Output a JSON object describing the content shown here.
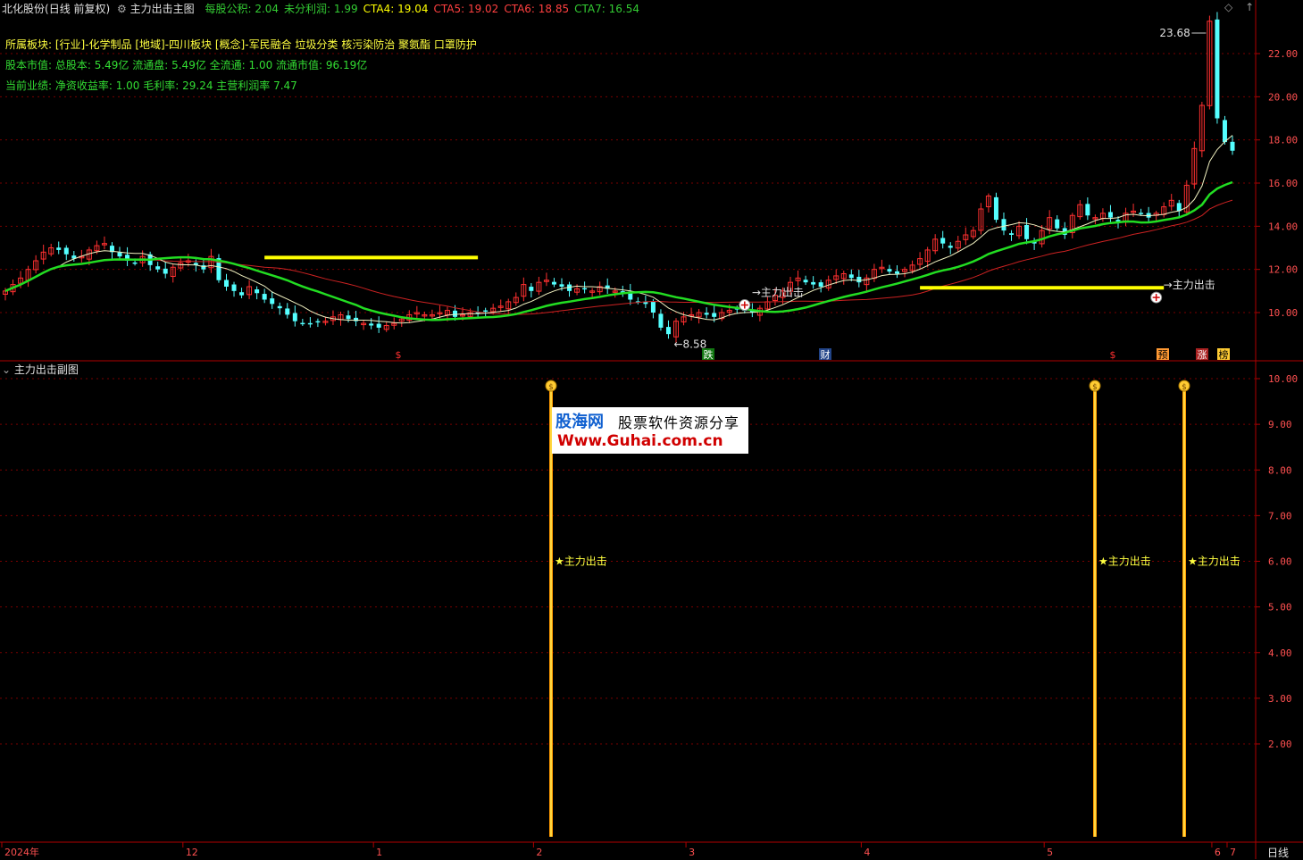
{
  "header": {
    "stock_name": "北化股份",
    "period": "(日线 前复权)",
    "indicator_main": "主力出击主图",
    "fields": [
      {
        "label": "每股公积:",
        "value": "2.04",
        "color": "#33cc33"
      },
      {
        "label": "未分利润:",
        "value": "1.99",
        "color": "#33cc33"
      },
      {
        "label": "CTA4:",
        "value": "19.04",
        "color": "#ffff00"
      },
      {
        "label": "CTA5:",
        "value": "19.02",
        "color": "#ff4040"
      },
      {
        "label": "CTA6:",
        "value": "18.85",
        "color": "#ff4040"
      },
      {
        "label": "CTA7:",
        "value": "16.54",
        "color": "#33cc33"
      }
    ]
  },
  "info_lines": {
    "sector": "所属板块: [行业]-化学制品 [地域]-四川板块 [概念]-军民融合 垃圾分类 核污染防治 聚氨酯 口罩防护",
    "market_value": "股本市值: 总股本: 5.49亿 流通盘: 5.49亿 全流通: 1.00 流通市值: 96.19亿",
    "performance": "当前业绩: 净资收益率: 1.00 毛利率: 29.24 主营利润率 7.47"
  },
  "sub_panel_title": "主力出击副图",
  "period_label": "日线",
  "colors": {
    "up": "#ff3030",
    "down": "#54ffff",
    "ma_green": "#22dd22",
    "ma_red": "#cc2222",
    "ma_white": "#f0f0c0",
    "signal_bar": "#ffcc00",
    "axis": "#b00000",
    "grid": "#7a0000"
  },
  "chart_data": [
    {
      "type": "candlestick",
      "title": "主力出击主图",
      "ylim": [
        8.0,
        24.0
      ],
      "yticks": [
        "22.00",
        "20.00",
        "18.00",
        "16.00",
        "14.00",
        "12.00",
        "10.00"
      ],
      "x_months": [
        "2024年",
        "12",
        "1",
        "2",
        "3",
        "4",
        "5",
        "6",
        "7"
      ],
      "annotations": {
        "high_label": "23.68",
        "low_label": "8.58",
        "signal_text_1": "主力出击",
        "signal_text_2": "主力出击"
      },
      "event_badges": [
        {
          "text": "$",
          "color": "#ff3030",
          "bg": "none"
        },
        {
          "text": "跌",
          "color": "#ffffff",
          "bg": "#117711"
        },
        {
          "text": "财",
          "color": "#ffffff",
          "bg": "#224488"
        },
        {
          "text": "$",
          "color": "#ff3030",
          "bg": "none"
        },
        {
          "text": "预",
          "color": "#000000",
          "bg": "#ff9933"
        },
        {
          "text": "涨",
          "color": "#ffffff",
          "bg": "#aa2222"
        },
        {
          "text": "榜",
          "color": "#000000",
          "bg": "#ffcc33"
        }
      ],
      "closes": [
        11.0,
        11.3,
        11.6,
        12.0,
        12.4,
        12.8,
        13.0,
        12.9,
        12.7,
        12.5,
        12.6,
        12.9,
        13.1,
        13.2,
        12.8,
        12.6,
        12.4,
        12.3,
        12.6,
        12.2,
        12.0,
        11.8,
        12.1,
        12.3,
        12.4,
        12.2,
        12.0,
        12.6,
        11.5,
        11.2,
        11.0,
        10.8,
        11.2,
        10.9,
        10.6,
        10.4,
        10.2,
        9.9,
        9.6,
        9.5,
        9.5,
        9.6,
        9.6,
        9.8,
        9.9,
        9.7,
        9.6,
        9.5,
        9.4,
        9.3,
        9.4,
        9.5,
        9.7,
        9.9,
        10.0,
        9.9,
        9.9,
        10.0,
        10.1,
        9.8,
        9.9,
        10.0,
        10.0,
        10.1,
        10.2,
        10.3,
        10.5,
        10.7,
        11.3,
        11.0,
        11.4,
        11.5,
        11.3,
        11.2,
        11.0,
        11.1,
        11.1,
        11.0,
        11.2,
        11.1,
        11.0,
        10.9,
        10.6,
        10.5,
        10.4,
        10.0,
        9.3,
        9.0,
        9.6,
        9.8,
        9.9,
        10.0,
        9.9,
        9.8,
        10.0,
        10.1,
        10.2,
        10.1,
        10.0,
        10.2,
        10.5,
        10.8,
        11.0,
        11.4,
        11.6,
        11.4,
        11.3,
        11.2,
        11.5,
        11.7,
        11.8,
        11.6,
        11.4,
        11.6,
        12.0,
        12.1,
        11.9,
        11.8,
        12.0,
        12.2,
        12.5,
        12.9,
        13.4,
        13.2,
        13.0,
        13.3,
        13.6,
        13.8,
        14.8,
        15.4,
        14.3,
        13.8,
        13.6,
        14.0,
        13.4,
        13.2,
        13.8,
        14.4,
        13.9,
        13.6,
        14.5,
        15.0,
        14.5,
        14.4,
        14.6,
        14.4,
        14.2,
        14.6,
        14.7,
        14.6,
        14.4,
        14.6,
        14.9,
        15.2,
        14.7,
        15.9,
        17.6,
        19.6,
        23.5,
        19.0,
        17.9,
        17.5
      ]
    },
    {
      "type": "bar",
      "title": "主力出击副图",
      "ylim": [
        0,
        10
      ],
      "yticks": [
        "10.00",
        "9.00",
        "8.00",
        "7.00",
        "6.00",
        "5.00",
        "4.00",
        "3.00",
        "2.00"
      ],
      "signal_label": "★主力出击",
      "signal_value": 10,
      "signal_label_value": 6,
      "signals_at_index": [
        68,
        152,
        167
      ]
    }
  ],
  "watermark": {
    "brand": "股海网",
    "slogan": "股票软件资源分享",
    "url": "Www.Guhai.com.cn"
  }
}
